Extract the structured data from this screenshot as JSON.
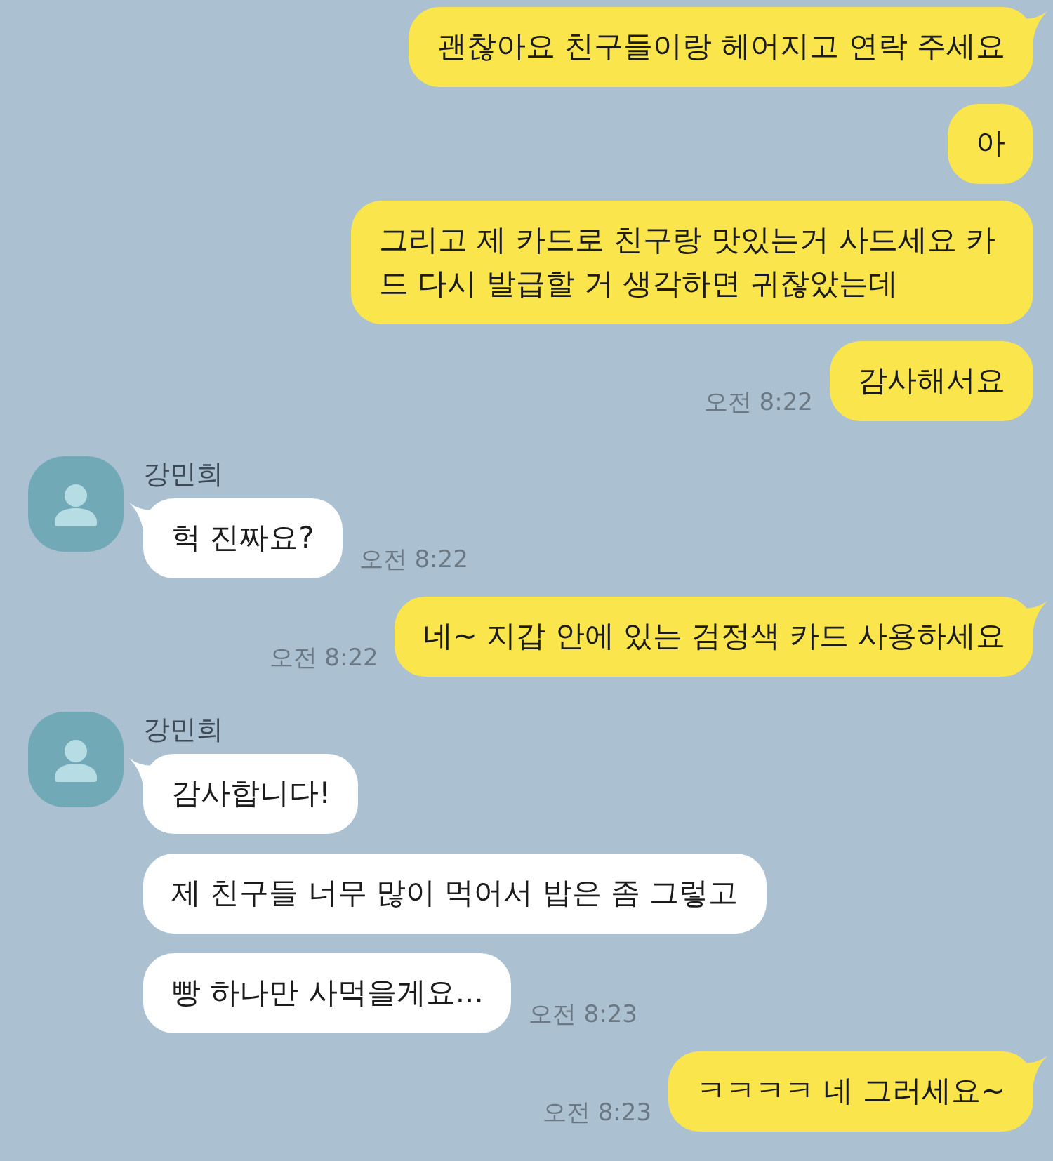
{
  "chat": [
    {
      "kind": "sent",
      "messages": [
        {
          "text": "괜찮아요 친구들이랑 헤어지고 연락 주세요"
        },
        {
          "text": "아"
        },
        {
          "text": "그리고 제 카드로 친구랑 맛있는거 사드세요 카드 다시 발급할 거 생각하면 귀찮았는데"
        },
        {
          "text": "감사해서요",
          "time": "오전 8:22"
        }
      ]
    },
    {
      "kind": "received",
      "name": "강민희",
      "messages": [
        {
          "text": "헉 진짜요?",
          "time": "오전 8:22"
        }
      ]
    },
    {
      "kind": "sent",
      "messages": [
        {
          "text": "네~ 지갑 안에 있는 검정색 카드 사용하세요",
          "time": "오전 8:22"
        }
      ]
    },
    {
      "kind": "received",
      "name": "강민희",
      "messages": [
        {
          "text": "감사합니다!"
        },
        {
          "text": "제 친구들 너무 많이 먹어서 밥은 좀 그렇고"
        },
        {
          "text": "빵 하나만 사먹을게요...",
          "time": "오전 8:23"
        }
      ]
    },
    {
      "kind": "sent",
      "messages": [
        {
          "text": "ㅋㅋㅋㅋ 네 그러세요~",
          "time": "오전 8:23"
        }
      ]
    }
  ]
}
